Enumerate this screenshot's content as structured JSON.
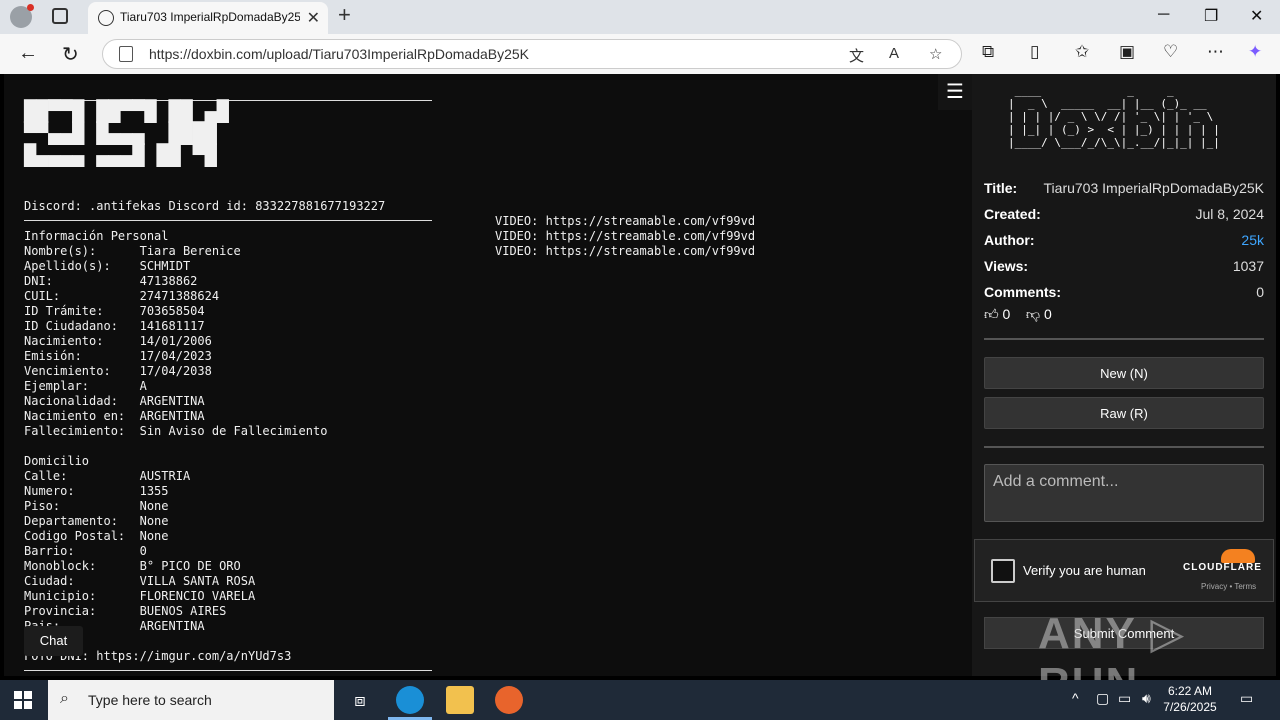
{
  "browser": {
    "tab_title": "Tiaru703 ImperialRpDomadaBy25K",
    "url": "https://doxbin.com/upload/Tiaru703ImperialRpDomadaBy25K"
  },
  "paste": {
    "banner": "██▀▀█ ██▀▀█ ██ ▄█\n▀▀▄▄█ █▄▄▄  ████ \n█▄▄▄▄ ▄▄▄█ ██ ▀█",
    "discord": "Discord: .antifekas Discord id: 833227881677193227",
    "info_lines": "Información Personal\nNombre(s):      Tiara Berenice\nApellido(s):    SCHMIDT\nDNI:            47138862\nCUIL:           27471388624\nID Trámite:     703658504\nID Ciudadano:   141681117\nNacimiento:     14/01/2006\nEmisión:        17/04/2023\nVencimiento:    17/04/2038\nEjemplar:       A\nNacionalidad:   ARGENTINA\nNacimiento en:  ARGENTINA\nFallecimiento:  Sin Aviso de Fallecimiento\n\nDomicilio\nCalle:          AUSTRIA\nNumero:         1355\nPiso:           None\nDepartamento:   None\nCodigo Postal:  None\nBarrio:         0\nMonoblock:      B° PICO DE ORO\nCiudad:         VILLA SANTA ROSA\nMunicipio:      FLORENCIO VARELA\nProvincia:      BUENOS AIRES\nPais:           ARGENTINA",
    "videos": "VIDEO: https://streamable.com/vf99vd\nVIDEO: https://streamable.com/vf99vd\nVIDEO: https://streamable.com/vf99vd",
    "foto": "FOTO DNI: https://imgur.com/a/nYUd7s3",
    "chat_label": "Chat"
  },
  "sidebar": {
    "logo": " ____             _     _       \n|  _ \\  _____  __| |__ (_)_ __  \n| | | |/ _ \\ \\/ /| '_ \\| | '_ \\ \n| |_| | (_) >  < | |_) | | | | |\n|____/ \\___/_/\\_\\|_.__/|_|_| |_|",
    "title_key": "Title:",
    "title_val": "Tiaru703 ImperialRpDomadaBy25K",
    "created_key": "Created:",
    "created_val": "Jul 8, 2024",
    "author_key": "Author:",
    "author_val": "25k",
    "views_key": "Views:",
    "views_val": "1037",
    "comments_key": "Comments:",
    "comments_val": "0",
    "upvotes": "0",
    "downvotes": "0",
    "new_label": "New (N)",
    "raw_label": "Raw (R)",
    "comment_placeholder": "Add a comment...",
    "verify_text": "Verify you are human",
    "cloudflare_label": "CLOUDFLARE",
    "cf_links": "Privacy  •  Terms",
    "submit_label": "Submit Comment"
  },
  "watermark": "ANY ▷ RUN",
  "taskbar": {
    "search_placeholder": "Type here to search",
    "time": "6:22 AM",
    "date": "7/26/2025"
  },
  "colors": {
    "page_bg": "#0d0d0d",
    "sidebar_bg": "#171717",
    "link": "#3ea6ff",
    "taskbar": "#1f2a38"
  }
}
